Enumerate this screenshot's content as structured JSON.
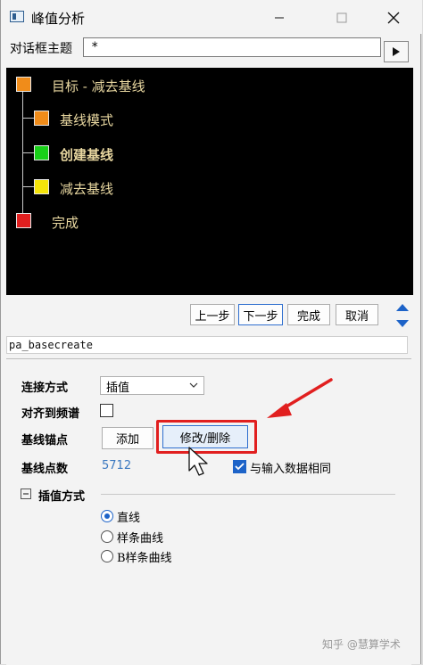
{
  "window": {
    "title": "峰值分析"
  },
  "theme": {
    "label": "对话框主题",
    "value": "*"
  },
  "tree": {
    "items": [
      {
        "label": "目标 - 减去基线",
        "color": "#f08c1a",
        "bold": false
      },
      {
        "label": "基线模式",
        "color": "#f08c1a",
        "bold": false
      },
      {
        "label": "创建基线",
        "color": "#18d018",
        "bold": true
      },
      {
        "label": "减去基线",
        "color": "#f4e40a",
        "bold": false
      },
      {
        "label": "完成",
        "color": "#e01f1f",
        "bold": false
      }
    ]
  },
  "nav": {
    "prev": "上一步",
    "next": "下一步",
    "finish": "完成",
    "cancel": "取消"
  },
  "status": {
    "page_name": "pa_basecreate"
  },
  "props": {
    "connect_label": "连接方式",
    "connect_value": "插值",
    "align_label": "对齐到频谱",
    "anchor_label": "基线锚点",
    "add_button": "添加",
    "modify_button": "修改/删除",
    "count_label": "基线点数",
    "count_value": "5712",
    "same_as_input_label": "与输入数据相同",
    "interp_section": "插值方式",
    "interp_options": [
      "直线",
      "样条曲线",
      "B样条曲线"
    ]
  },
  "watermark": "知乎 @慧算学术"
}
